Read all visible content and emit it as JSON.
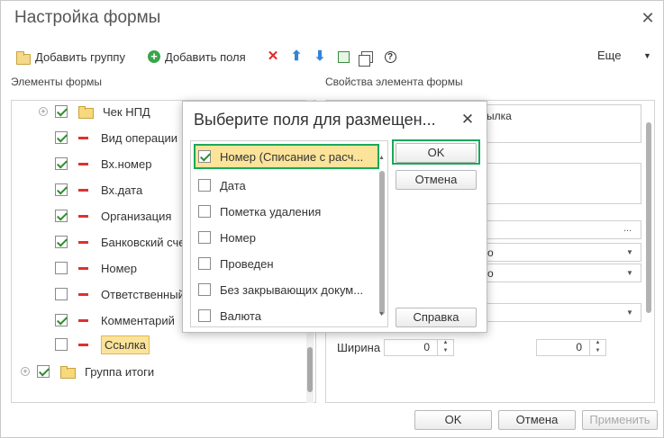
{
  "window": {
    "title": "Настройка формы",
    "close": "✕"
  },
  "toolbar": {
    "add_group": "Добавить группу",
    "add_fields": "Добавить поля",
    "delete_icon": "✕",
    "up_icon": "⬆",
    "down_icon": "⬇",
    "help_icon": "?",
    "more": "Еще",
    "more_arrow": "▼"
  },
  "left": {
    "label": "Элементы формы",
    "items": [
      {
        "label": "Чек НПД",
        "checked": true,
        "type": "group"
      },
      {
        "label": "Вид операции",
        "checked": true,
        "type": "field"
      },
      {
        "label": "Вх.номер",
        "checked": true,
        "type": "field"
      },
      {
        "label": "Вх.дата",
        "checked": true,
        "type": "field"
      },
      {
        "label": "Организация",
        "checked": true,
        "type": "field"
      },
      {
        "label": "Банковский сче",
        "checked": true,
        "type": "field"
      },
      {
        "label": "Номер",
        "checked": false,
        "type": "field"
      },
      {
        "label": "Ответственный",
        "checked": false,
        "type": "field"
      },
      {
        "label": "Комментарий",
        "checked": true,
        "type": "field"
      },
      {
        "label": "Ссылка",
        "checked": false,
        "type": "field",
        "selected": true
      },
      {
        "label": "Группа итоги",
        "checked": true,
        "type": "group"
      }
    ]
  },
  "right": {
    "label": "Свойства элемента формы",
    "title_text": "ылка",
    "combo1": "о",
    "combo2": "о",
    "width_label": "Ширина",
    "width_value": "0",
    "height_value": "0"
  },
  "dialog": {
    "title": "Выберите поля для размещен...",
    "close": "✕",
    "items": [
      {
        "label": "Номер (Списание с расч...",
        "checked": true,
        "highlighted": true
      },
      {
        "label": "Дата",
        "checked": false
      },
      {
        "label": "Пометка удаления",
        "checked": false
      },
      {
        "label": "Номер",
        "checked": false
      },
      {
        "label": "Проведен",
        "checked": false
      },
      {
        "label": "Без закрывающих докум...",
        "checked": false
      },
      {
        "label": "Валюта",
        "checked": false
      }
    ],
    "ok": "OK",
    "cancel": "Отмена",
    "help": "Справка"
  },
  "footer": {
    "ok": "OK",
    "cancel": "Отмена",
    "apply": "Применить"
  }
}
